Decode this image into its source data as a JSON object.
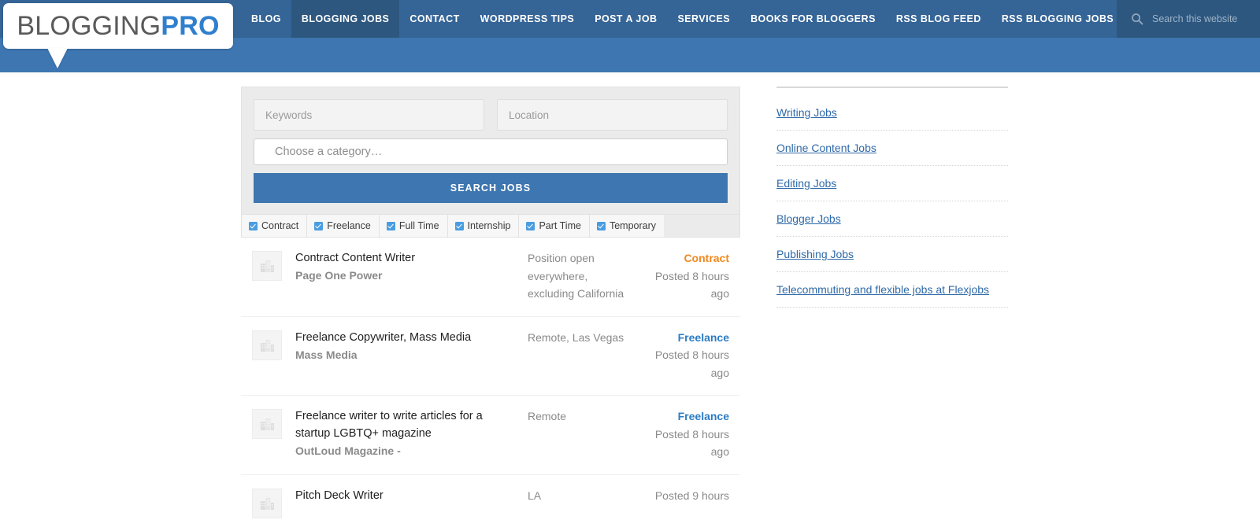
{
  "site": {
    "logo_primary": "BLOGGING",
    "logo_accent": "PRO"
  },
  "nav": {
    "items": [
      {
        "label": "BLOG",
        "active": false
      },
      {
        "label": "BLOGGING JOBS",
        "active": true
      },
      {
        "label": "CONTACT",
        "active": false
      },
      {
        "label": "WORDPRESS TIPS",
        "active": false
      },
      {
        "label": "POST A JOB",
        "active": false
      },
      {
        "label": "SERVICES",
        "active": false
      },
      {
        "label": "BOOKS FOR BLOGGERS",
        "active": false
      },
      {
        "label": "RSS BLOG FEED",
        "active": false
      },
      {
        "label": "RSS BLOGGING JOBS FEED",
        "active": false
      }
    ],
    "search": {
      "placeholder": "Search this website",
      "value": "",
      "icon": "search-icon"
    }
  },
  "job_search": {
    "keywords": {
      "placeholder": "Keywords",
      "value": ""
    },
    "location": {
      "placeholder": "Location",
      "value": ""
    },
    "category": {
      "selected": "Choose a category…"
    },
    "submit_label": "SEARCH JOBS",
    "filters": [
      {
        "label": "Contract",
        "checked": true
      },
      {
        "label": "Freelance",
        "checked": true
      },
      {
        "label": "Full Time",
        "checked": true
      },
      {
        "label": "Internship",
        "checked": true
      },
      {
        "label": "Part Time",
        "checked": true
      },
      {
        "label": "Temporary",
        "checked": true
      }
    ]
  },
  "jobs": [
    {
      "title": "Contract Content Writer",
      "company": "Page One Power",
      "location": "Position open everywhere, excluding California",
      "type": "Contract",
      "type_color": "#f08820",
      "type_class": "contract",
      "posted": "Posted 8 hours ago"
    },
    {
      "title": "Freelance Copywriter, Mass Media",
      "company": "Mass Media",
      "location": "Remote, Las Vegas",
      "type": "Freelance",
      "type_color": "#2b7cc4",
      "type_class": "freelance",
      "posted": "Posted 8 hours ago"
    },
    {
      "title": "Freelance writer to write articles for a startup LGBTQ+ magazine",
      "company": "OutLoud Magazine -",
      "location": "Remote",
      "type": "Freelance",
      "type_color": "#2b7cc4",
      "type_class": "freelance",
      "posted": "Posted 8 hours ago"
    },
    {
      "title": "Pitch Deck Writer",
      "company": "",
      "location": "LA",
      "type": "",
      "type_color": "#2b7cc4",
      "type_class": "freelance",
      "posted": "Posted 9 hours"
    }
  ],
  "sidebar": {
    "links": [
      {
        "label": "Writing Jobs"
      },
      {
        "label": "Online Content Jobs"
      },
      {
        "label": "Editing Jobs"
      },
      {
        "label": "Blogger Jobs"
      },
      {
        "label": "Publishing Jobs"
      },
      {
        "label": "Telecommuting and flexible jobs at Flexjobs"
      }
    ]
  },
  "colors": {
    "header_blue": "#3d76b0",
    "nav_blue": "#356496",
    "nav_active": "#2d577f",
    "accent_orange": "#f08820",
    "link_blue": "#2f6aa8"
  }
}
